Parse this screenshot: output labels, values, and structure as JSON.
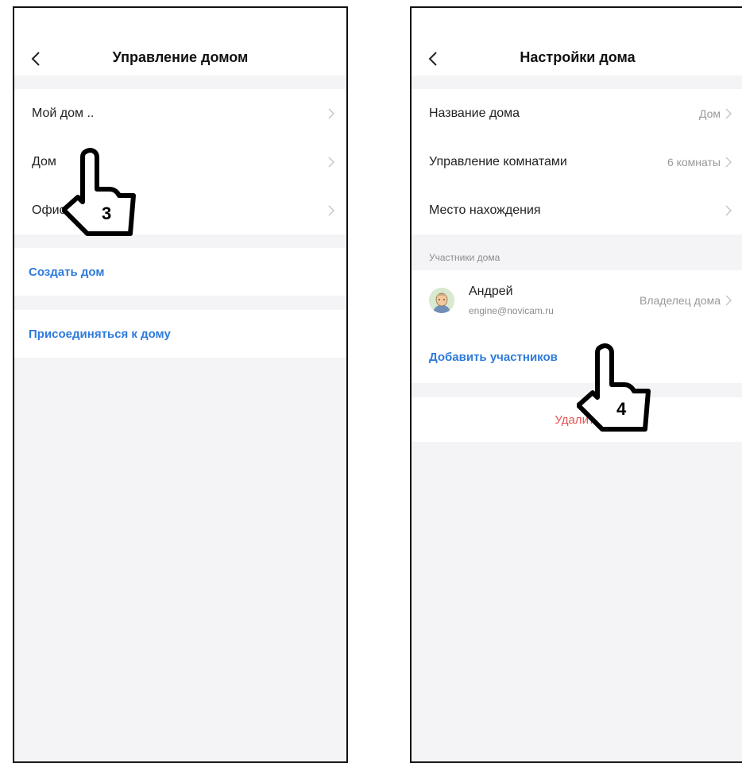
{
  "left_screen": {
    "title": "Управление домом",
    "homes": [
      {
        "label": "Мой дом .."
      },
      {
        "label": "Дом"
      },
      {
        "label": "Офис"
      }
    ],
    "create_home": "Создать дом",
    "join_home": "Присоединяться к дому",
    "step_number": "3"
  },
  "right_screen": {
    "title": "Настройки дома",
    "settings": [
      {
        "label": "Название дома",
        "value": "Дом"
      },
      {
        "label": "Управление комнатами",
        "value": "6 комнаты"
      },
      {
        "label": "Место нахождения",
        "value": ""
      }
    ],
    "members_caption": "Участники дома",
    "member": {
      "name": "Андрей",
      "email": "engine@novicam.ru",
      "role": "Владелец дома"
    },
    "add_members": "Добавить участников",
    "delete_home": "Удалить",
    "step_number": "4"
  },
  "colors": {
    "accent": "#2e7bdc",
    "danger": "#e65353",
    "background": "#f4f4f6"
  },
  "icons": [
    "back-arrow-icon",
    "chevron-right-icon",
    "pointing-hand-icon",
    "user-avatar-icon"
  ]
}
